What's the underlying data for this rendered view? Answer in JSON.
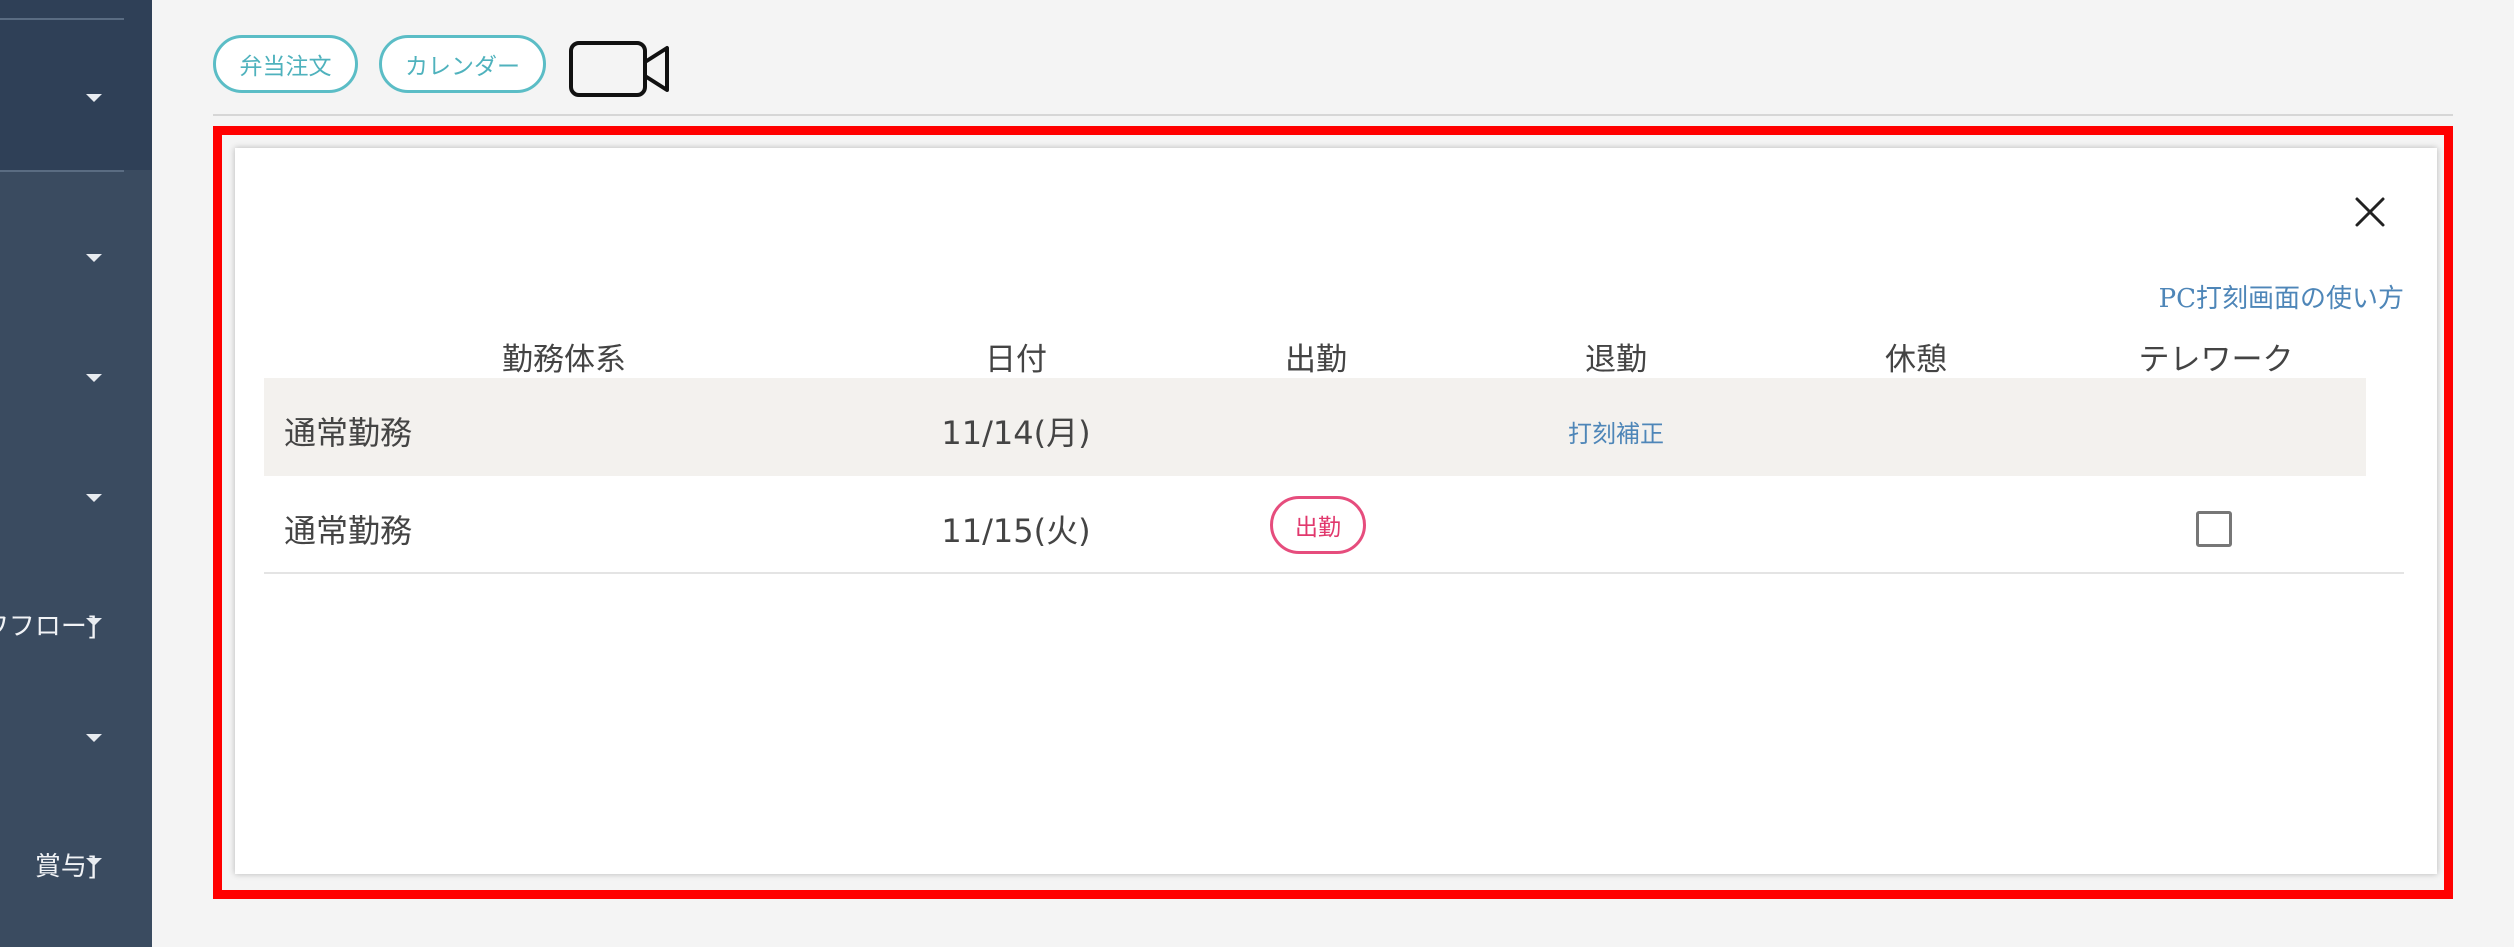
{
  "sidebar": {
    "items": [
      {
        "label": ""
      },
      {
        "label": ""
      },
      {
        "label": ""
      },
      {
        "label": ""
      },
      {
        "label": "ワフロー]"
      },
      {
        "label": ""
      },
      {
        "label": "賞与]"
      }
    ]
  },
  "toolbar": {
    "bento_label": "弁当注文",
    "calendar_label": "カレンダー",
    "video_icon": "video-camera-icon"
  },
  "modal": {
    "close_icon": "close-icon",
    "help_link": "PC打刻画面の使い方",
    "headers": {
      "work_type": "勤務体系",
      "date": "日付",
      "clock_in": "出勤",
      "clock_out": "退勤",
      "break": "休憩",
      "telework": "テレワーク"
    },
    "rows": [
      {
        "work_type": "通常勤務",
        "date": "11/14(月)",
        "clock_out_link": "打刻補正"
      },
      {
        "work_type": "通常勤務",
        "date": "11/15(火)",
        "clock_in_button": "出勤",
        "telework_checked": false
      }
    ]
  },
  "colors": {
    "sidebar_bg": "#3a4b60",
    "accent_teal": "#5bbdc6",
    "clock_in_pink": "#e64d7d",
    "link_blue": "#4e86b8",
    "highlight_red": "#ff0000"
  }
}
